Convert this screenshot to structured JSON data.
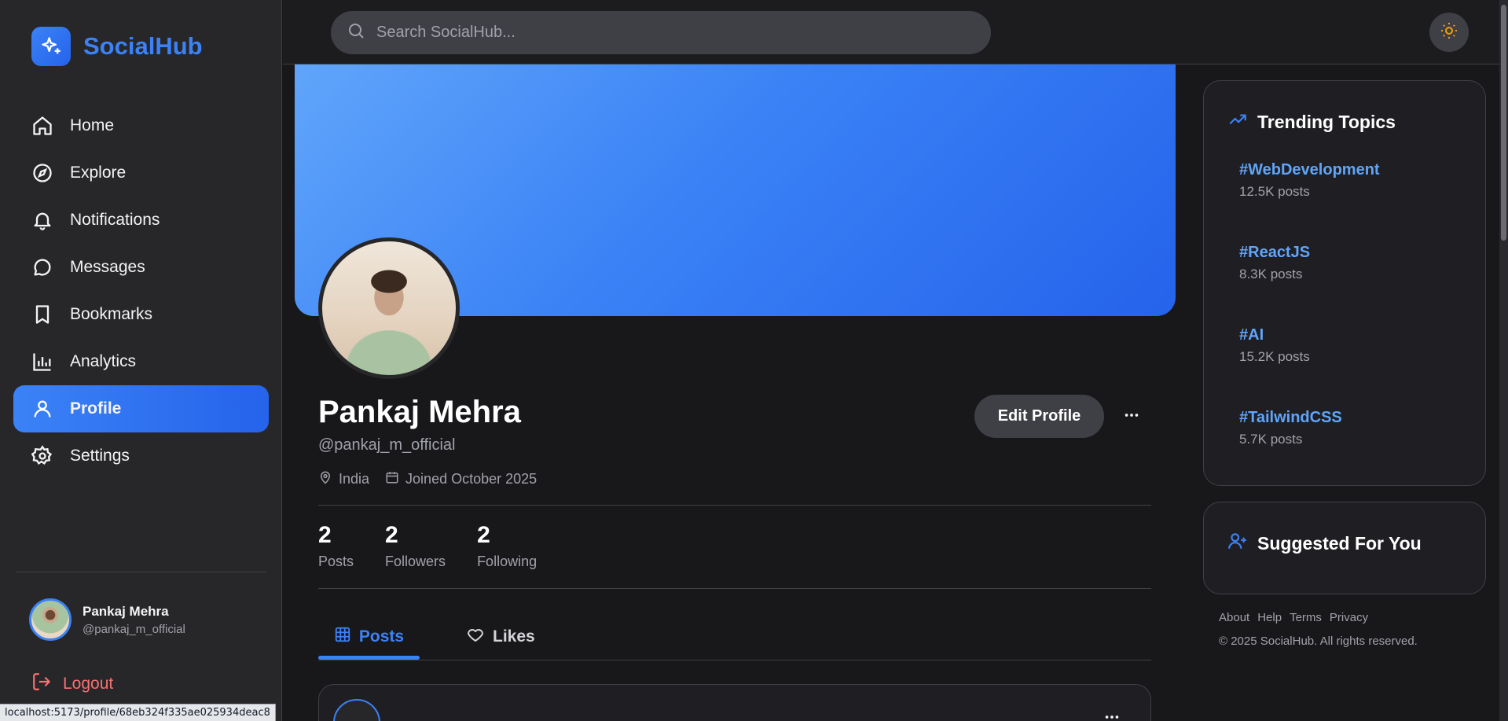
{
  "app": {
    "name": "SocialHub"
  },
  "sidebar": {
    "items": [
      {
        "label": "Home",
        "icon": "home-icon"
      },
      {
        "label": "Explore",
        "icon": "compass-icon"
      },
      {
        "label": "Notifications",
        "icon": "bell-icon"
      },
      {
        "label": "Messages",
        "icon": "message-icon"
      },
      {
        "label": "Bookmarks",
        "icon": "bookmark-icon"
      },
      {
        "label": "Analytics",
        "icon": "bar-chart-icon"
      },
      {
        "label": "Profile",
        "icon": "user-icon",
        "active": true
      },
      {
        "label": "Settings",
        "icon": "gear-icon"
      }
    ],
    "user": {
      "name": "Pankaj Mehra",
      "handle": "@pankaj_m_official"
    },
    "logout_label": "Logout"
  },
  "topbar": {
    "search_placeholder": "Search SocialHub...",
    "theme_icon": "sun-icon"
  },
  "profile": {
    "name": "Pankaj Mehra",
    "handle": "@pankaj_m_official",
    "location": "India",
    "joined": "Joined October 2025",
    "edit_label": "Edit Profile",
    "stats": [
      {
        "value": "2",
        "label": "Posts"
      },
      {
        "value": "2",
        "label": "Followers"
      },
      {
        "value": "2",
        "label": "Following"
      }
    ],
    "tabs": [
      {
        "label": "Posts",
        "active": true
      },
      {
        "label": "Likes"
      }
    ]
  },
  "trending": {
    "title": "Trending Topics",
    "topics": [
      {
        "tag": "#WebDevelopment",
        "count": "12.5K posts"
      },
      {
        "tag": "#ReactJS",
        "count": "8.3K posts"
      },
      {
        "tag": "#AI",
        "count": "15.2K posts"
      },
      {
        "tag": "#TailwindCSS",
        "count": "5.7K posts"
      }
    ]
  },
  "suggested": {
    "title": "Suggested For You"
  },
  "footer": {
    "links": [
      "About",
      "Help",
      "Terms",
      "Privacy"
    ],
    "copyright": "© 2025 SocialHub. All rights reserved."
  },
  "status_bar": {
    "url": "localhost:5173/profile/68eb324f335ae025934deac8"
  },
  "colors": {
    "accent": "#3b82f6",
    "background": "#18181b",
    "panel": "#27272a",
    "danger": "#f87171"
  }
}
